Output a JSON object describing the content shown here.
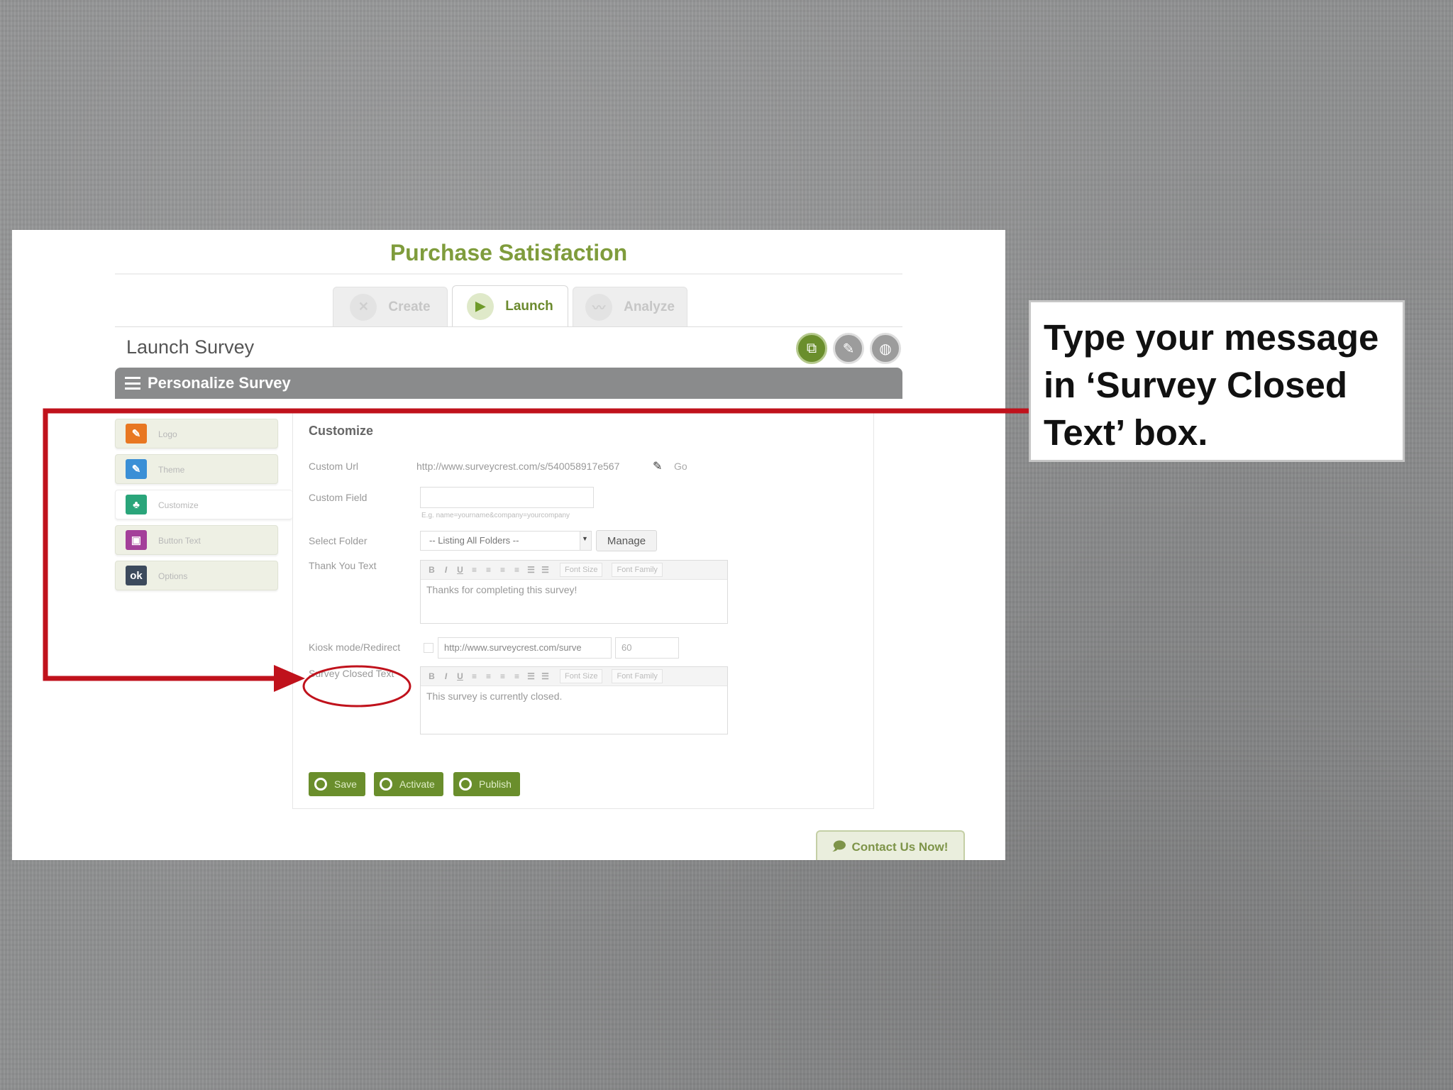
{
  "callout": {
    "text": "Type your message in ‘Survey Closed Text’ box."
  },
  "app": {
    "title": "Purchase Satisfaction"
  },
  "tabs": [
    {
      "label": "Create",
      "icon": "tools-icon",
      "active": false
    },
    {
      "label": "Launch",
      "icon": "play-icon",
      "active": true
    },
    {
      "label": "Analyze",
      "icon": "chart-icon",
      "active": false
    }
  ],
  "launch": {
    "page_title": "Launch Survey"
  },
  "personalize": {
    "title": "Personalize Survey"
  },
  "sidebar": {
    "items": [
      {
        "label": "Logo",
        "icon": "logo-icon",
        "color": "#e87722"
      },
      {
        "label": "Theme",
        "icon": "theme-icon",
        "color": "#3a8fd6"
      },
      {
        "label": "Customize",
        "icon": "customize-icon",
        "color": "#2aa57a",
        "active": true
      },
      {
        "label": "Button Text",
        "icon": "button-text-icon",
        "color": "#a43f9a"
      },
      {
        "label": "Options",
        "icon": "options-icon",
        "color": "#3c4a5c"
      }
    ]
  },
  "customize": {
    "title": "Customize",
    "custom_url_label": "Custom Url",
    "custom_url_value": "http://www.surveycrest.com/s/540058917e567",
    "go_label": "Go",
    "custom_field_label": "Custom Field",
    "custom_field_value": "",
    "custom_field_hint": "E.g. name=yourname&company=yourcompany",
    "select_folder_label": "Select Folder",
    "select_folder_value": "-- Listing All Folders --",
    "manage_label": "Manage",
    "thank_you_label": "Thank You Text",
    "thank_you_text": "Thanks for completing this survey!",
    "kiosk_label": "Kiosk mode/Redirect",
    "kiosk_url": "http://www.surveycrest.com/surve",
    "kiosk_seconds": "60",
    "survey_closed_label": "Survey Closed Text",
    "survey_closed_text": "This survey is currently closed.",
    "font_size_label": "Font Size",
    "font_family_label": "Font Family"
  },
  "actions": {
    "save": "Save",
    "activate": "Activate",
    "publish": "Publish"
  },
  "contact": {
    "label": "Contact Us Now!"
  },
  "colors": {
    "annotation_red": "#c0121c",
    "brand_green": "#6a8e2c"
  }
}
